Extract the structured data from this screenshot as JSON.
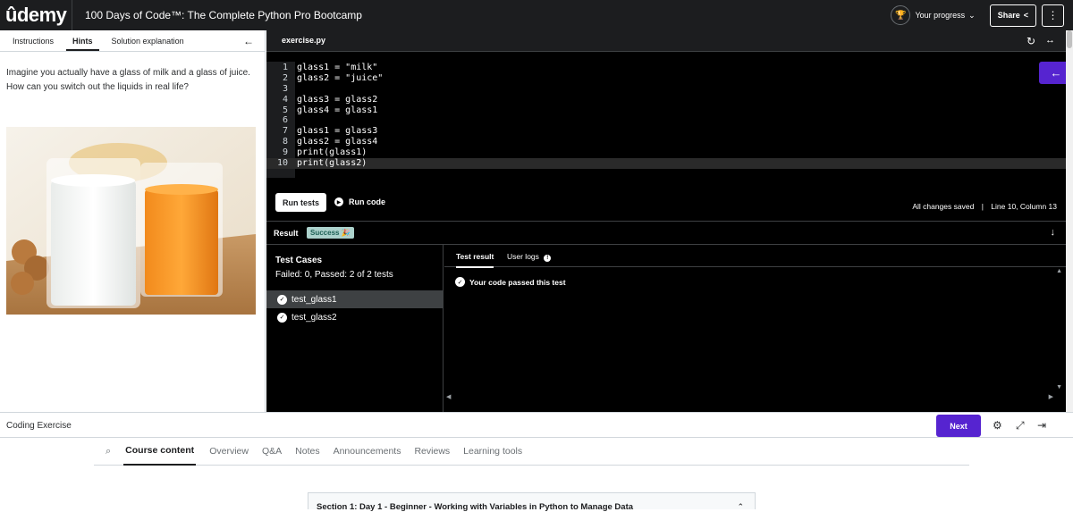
{
  "header": {
    "logo": "ûdemy",
    "course_title": "100 Days of Code™: The Complete Python Pro Bootcamp",
    "progress_label": "Your progress",
    "share_label": "Share",
    "more_icon": "vertical-dots-icon"
  },
  "left_panel": {
    "tabs": [
      {
        "label": "Instructions",
        "active": false
      },
      {
        "label": "Hints",
        "active": true
      },
      {
        "label": "Solution explanation",
        "active": false
      }
    ],
    "hint_text": "Imagine you actually have a glass of milk and a glass of juice. How can you switch out the liquids in real life?"
  },
  "editor": {
    "file_tab": "exercise.py",
    "lines": [
      {
        "n": "1",
        "code": "glass1 = \"milk\""
      },
      {
        "n": "2",
        "code": "glass2 = \"juice\""
      },
      {
        "n": "3",
        "code": ""
      },
      {
        "n": "4",
        "code": "glass3 = glass2"
      },
      {
        "n": "5",
        "code": "glass4 = glass1"
      },
      {
        "n": "6",
        "code": ""
      },
      {
        "n": "7",
        "code": "glass1 = glass3"
      },
      {
        "n": "8",
        "code": "glass2 = glass4"
      },
      {
        "n": "9",
        "code": "print(glass1)"
      },
      {
        "n": "10",
        "code": "print(glass2)"
      }
    ],
    "run_tests_label": "Run tests",
    "run_code_label": "Run code",
    "saved_status": "All changes saved",
    "separator": "|",
    "cursor_position": "Line 10, Column 13"
  },
  "result": {
    "label": "Result",
    "status_badge": "Success 🎉",
    "test_cases_title": "Test Cases",
    "summary": "Failed: 0, Passed: 2 of 2 tests",
    "cases": [
      "test_glass1",
      "test_glass2"
    ],
    "tabs": {
      "test_result": "Test result",
      "user_logs": "User logs"
    },
    "pass_message": "Your code passed this test"
  },
  "footer": {
    "coding_label": "Coding Exercise",
    "next_label": "Next"
  },
  "nav": {
    "tabs": [
      {
        "label": "Course content",
        "active": true
      },
      {
        "label": "Overview",
        "active": false
      },
      {
        "label": "Q&A",
        "active": false
      },
      {
        "label": "Notes",
        "active": false
      },
      {
        "label": "Announcements",
        "active": false
      },
      {
        "label": "Reviews",
        "active": false
      },
      {
        "label": "Learning tools",
        "active": false
      }
    ]
  },
  "section": {
    "title": "Section 1: Day 1 - Beginner - Working with Variables in Python to Manage Data"
  },
  "colors": {
    "brand_purple": "#5624d0",
    "topbar": "#1c1d1f",
    "success_badge": "#acd2cc"
  }
}
